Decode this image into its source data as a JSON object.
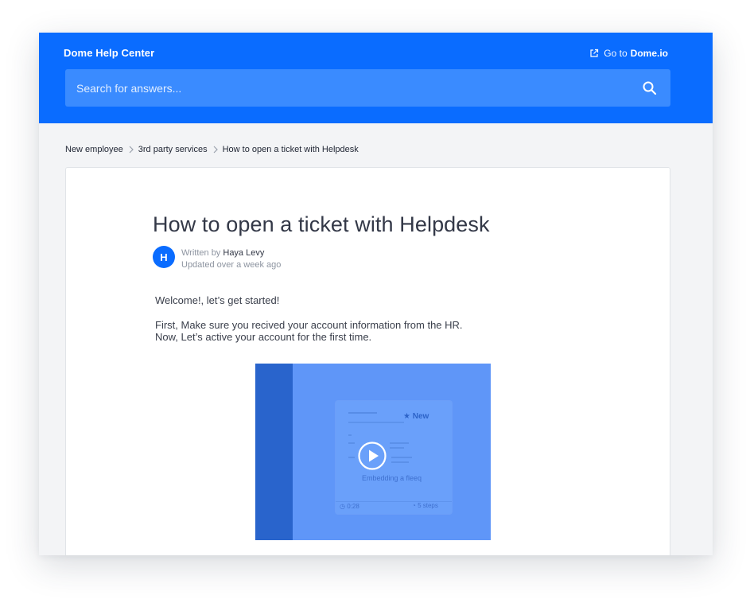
{
  "header": {
    "brand": "Dome Help Center",
    "goto_prefix": "Go to",
    "goto_domain": "Dome.io",
    "search_placeholder": "Search for answers..."
  },
  "breadcrumb": {
    "items": [
      "New employee",
      "3rd party services",
      "How to open a ticket with Helpdesk"
    ]
  },
  "article": {
    "title": "How to open a ticket with Helpdesk",
    "avatar_letter": "H",
    "written_by_prefix": "Written by",
    "author": "Haya Levy",
    "updated": "Updated over a week ago",
    "paragraphs": [
      "Welcome!, let’s get started!",
      "First, Make sure you recived your account information from the HR.",
      "Now, Let’s active your account for the first time."
    ]
  },
  "video": {
    "badge": "New",
    "caption": "Embedding a fleeq",
    "duration": "0:28",
    "steps": "5 steps"
  },
  "colors": {
    "accent": "#0a6cff",
    "search_bg": "#3a8bff",
    "page_bg": "#f3f4f6",
    "video_bg": "#5f96f8"
  },
  "icons": [
    "external-link-icon",
    "search-icon",
    "chevron-right-icon",
    "play-icon",
    "star-icon",
    "clock-icon"
  ]
}
